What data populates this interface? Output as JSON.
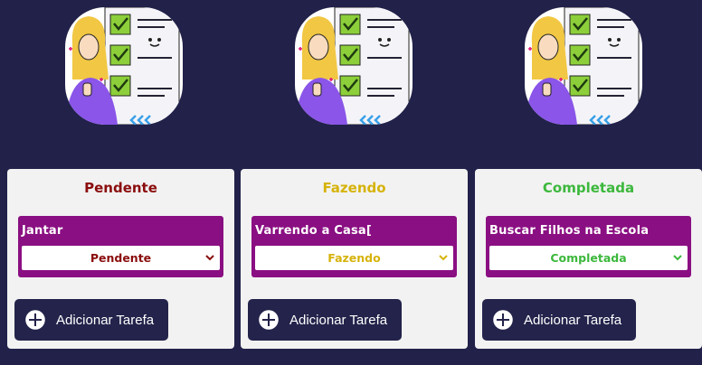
{
  "columns": [
    {
      "title": "Pendente",
      "title_color": "#8b0d0d",
      "task": {
        "name": "Jantar",
        "status": "Pendente"
      },
      "add_button": "Adicionar Tarefa"
    },
    {
      "title": "Fazendo",
      "title_color": "#d6b30a",
      "task": {
        "name": "Varrendo a Casa[",
        "status": "Fazendo"
      },
      "add_button": "Adicionar Tarefa"
    },
    {
      "title": "Completada",
      "title_color": "#3cb83c",
      "task": {
        "name": "Buscar Filhos na Escola",
        "status": "Completada"
      },
      "add_button": "Adicionar Tarefa"
    }
  ],
  "icons": {
    "hero": "checklist-illustration",
    "select": "chevron-down-icon",
    "add": "plus-circle-icon"
  },
  "colors": {
    "background": "#21214a",
    "task_card": "#8a0f82",
    "button": "#23234b"
  }
}
